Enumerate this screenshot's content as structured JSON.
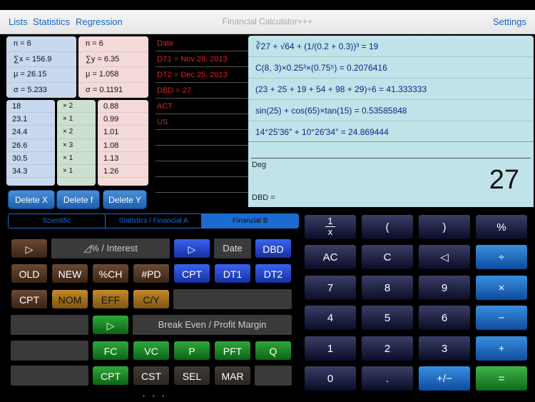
{
  "nav": {
    "lists": "Lists",
    "statistics": "Statistics",
    "regression": "Regression",
    "title": "Financial Calculator+++",
    "settings": "Settings"
  },
  "stats": {
    "x": [
      "n = 6",
      "∑x = 156.9",
      "μ = 26.15",
      "σ = 5.233"
    ],
    "y": [
      "n = 6",
      "∑y = 6.35",
      "μ = 1.058",
      "σ = 0.1191"
    ]
  },
  "lists": {
    "x": [
      "18",
      "23.1",
      "24.4",
      "26.6",
      "30.5",
      "34.3"
    ],
    "f": [
      "× 2",
      "× 1",
      "× 2",
      "× 3",
      "× 1",
      "× 1"
    ],
    "y": [
      "0.88",
      "0.99",
      "1.01",
      "1.08",
      "1.13",
      "1.26"
    ]
  },
  "delete": {
    "x": "Delete X",
    "f": "Delete f",
    "y": "Delete Y"
  },
  "dates": [
    "Date",
    "DT1 = Nov 28, 2013",
    "DT2 = Dec 25, 2013",
    "DBD = 27",
    "ACT",
    "US"
  ],
  "history": [
    "∛27 + √64 + (1/(0.2 + 0.3))³ = 19",
    "C(8, 3)×0.25³×(0.75⁵) = 0.2076416",
    "(23 + 25 + 19 + 54 + 98 + 29)÷6 = 41.333333",
    "sin(25) + cos(65)×tan(15) = 0.53585848",
    "14°25′36″ + 10°26′34″ = 24.869444"
  ],
  "display": {
    "mode": "Deg",
    "value": "27",
    "sub": "DBD ="
  },
  "tabs": [
    "Scientific",
    "Statistics / Financial A",
    "Financial B"
  ],
  "fn": {
    "play": "▷",
    "interest": "◿% / Interest",
    "date": "Date",
    "dbd": "DBD",
    "old": "OLD",
    "new": "NEW",
    "pch": "%CH",
    "pd": "#PD",
    "cpt": "CPT",
    "dt1": "DT1",
    "dt2": "DT2",
    "cpt2": "CPT",
    "nom": "NOM",
    "eff": "EFF",
    "cy": "C/Y",
    "breakeven": "Break Even / Profit Margin",
    "fc": "FC",
    "vc": "VC",
    "p": "P",
    "pft": "PFT",
    "q": "Q",
    "cpt3": "CPT",
    "cst": "CST",
    "sel": "SEL",
    "mar": "MAR"
  },
  "keys": {
    "recip_num": "1",
    "recip_den": "x",
    "lparen": "(",
    "rparen": ")",
    "pct": "%",
    "ac": "AC",
    "c": "C",
    "back": "◁",
    "div": "÷",
    "k7": "7",
    "k8": "8",
    "k9": "9",
    "mul": "×",
    "k4": "4",
    "k5": "5",
    "k6": "6",
    "sub": "−",
    "k1": "1",
    "k2": "2",
    "k3": "3",
    "add": "+",
    "k0": "0",
    "dot": ".",
    "neg": "+/−",
    "eq": "="
  },
  "page_dots": "• • •"
}
